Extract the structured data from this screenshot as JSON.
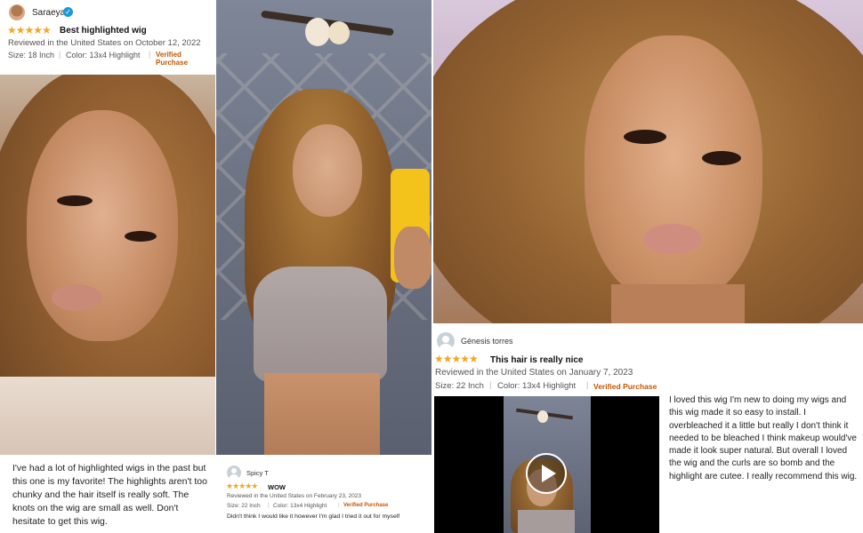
{
  "review1": {
    "reviewer": "Saraeya",
    "stars": "★★★★★",
    "title": "Best highlighted wig",
    "meta": "Reviewed in the United States on October 12, 2022",
    "size": "Size: 18 Inch",
    "color": "Color: 13x4 Highlight",
    "verified": "Verified Purchase",
    "body": "I've had a lot of highlighted wigs in the past but this one is my favorite! The highlights aren't too chunky and the hair itself is really soft. The knots on the wig are small as well. Don't hesitate to get this wig."
  },
  "review2": {
    "reviewer": "Spicy T",
    "stars": "★★★★★",
    "title": "WOW",
    "meta": "Reviewed in the United States on February 23, 2023",
    "size": "Size: 22 Inch",
    "color": "Color: 13x4 Highlight",
    "verified": "Verified Purchase",
    "body": "Didn't think I would like it however I'm glad I tried it out for myself"
  },
  "review3": {
    "reviewer": "Génesis torres",
    "stars": "★★★★★",
    "title": "This hair is really nice",
    "meta": "Reviewed in the United States on January 7, 2023",
    "size": "Size: 22 Inch",
    "color": "Color: 13x4 Highlight",
    "verified": "Verified Purchase",
    "body": "I loved this wig I'm new to doing my wigs and this wig made it so easy to install. I overbleached it a little but really I don't think it needed to be bleached I think makeup would've made it look super natural. But overall I loved the wig and the curls are so bomb and the highlight are cutee. I really recommend this wig."
  },
  "colors": {
    "star": "#f5a623",
    "verified": "#c45500",
    "verified_badge": "#1a9cd8"
  }
}
